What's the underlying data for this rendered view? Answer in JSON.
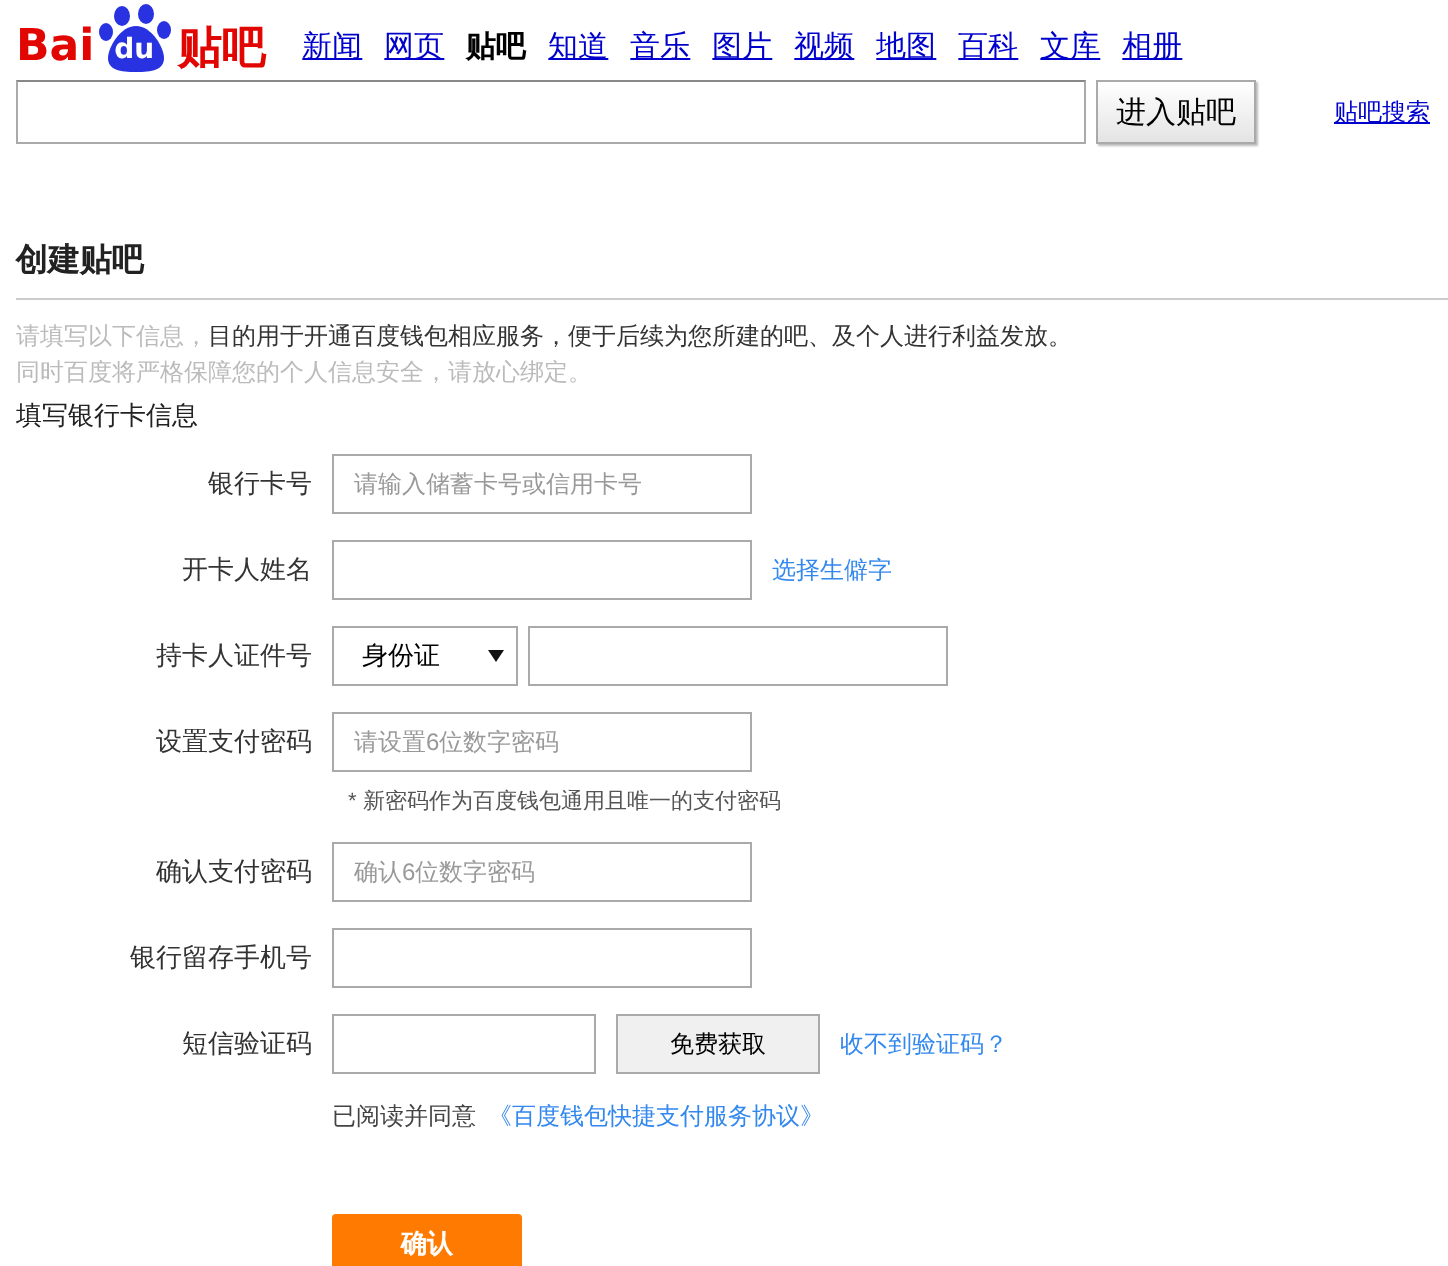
{
  "logo": {
    "left": "Bai",
    "paw": "du",
    "right": "贴吧"
  },
  "nav": [
    {
      "label": "新闻",
      "selected": false
    },
    {
      "label": "网页",
      "selected": false
    },
    {
      "label": "贴吧",
      "selected": true
    },
    {
      "label": "知道",
      "selected": false
    },
    {
      "label": "音乐",
      "selected": false
    },
    {
      "label": "图片",
      "selected": false
    },
    {
      "label": "视频",
      "selected": false
    },
    {
      "label": "地图",
      "selected": false
    },
    {
      "label": "百科",
      "selected": false
    },
    {
      "label": "文库",
      "selected": false
    },
    {
      "label": "相册",
      "selected": false
    }
  ],
  "search": {
    "button": "进入贴吧",
    "link": "贴吧搜索"
  },
  "title": "创建贴吧",
  "intro": {
    "lead": "请填写以下信息，",
    "rest": "目的用于开通百度钱包相应服务，便于后续为您所建的吧、及个人进行利益发放。",
    "line2": "同时百度将严格保障您的个人信息安全，请放心绑定。"
  },
  "section": "填写银行卡信息",
  "rows": [
    {
      "kind": "input",
      "label": "银行卡号",
      "placeholder": "请输入储蓄卡号或信用卡号"
    },
    {
      "kind": "input-link",
      "label": "开卡人姓名",
      "link": "选择生僻字"
    },
    {
      "kind": "select-input",
      "label": "持卡人证件号",
      "select": "身份证"
    },
    {
      "kind": "input",
      "label": "设置支付密码",
      "placeholder": "请设置6位数字密码",
      "note": "* 新密码作为百度钱包通用且唯一的支付密码"
    },
    {
      "kind": "input",
      "label": "确认支付密码",
      "placeholder": "确认6位数字密码"
    },
    {
      "kind": "input",
      "label": "银行留存手机号"
    },
    {
      "kind": "sms",
      "label": "短信验证码",
      "button": "免费获取",
      "link": "收不到验证码？"
    }
  ],
  "agreement": {
    "text": "已阅读并同意",
    "link": "《百度钱包快捷支付服务协议》"
  },
  "submit": "确认"
}
